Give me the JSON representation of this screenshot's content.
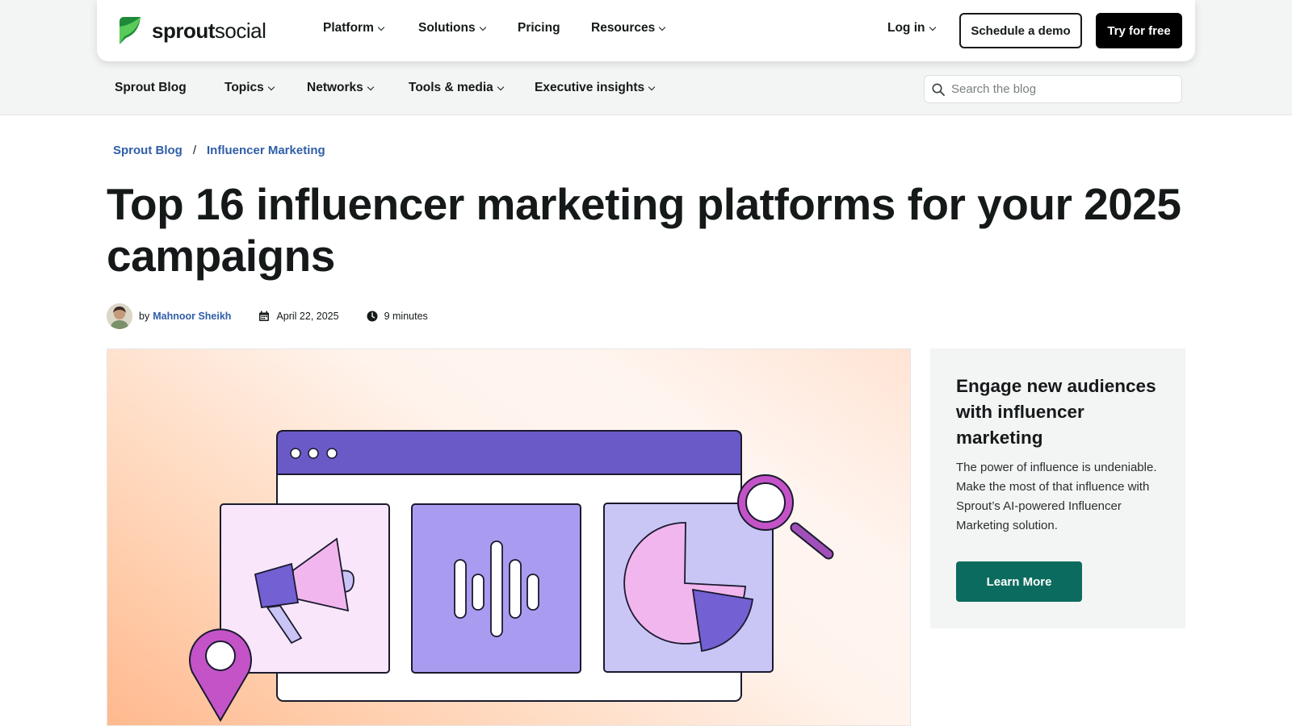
{
  "brand": {
    "logo_bold": "sprout",
    "logo_light": "social",
    "logo_icon": "sprout-leaf-icon",
    "accent_color": "#59cb59"
  },
  "main_nav": {
    "items": [
      {
        "label": "Platform",
        "has_dropdown": true
      },
      {
        "label": "Solutions",
        "has_dropdown": true
      },
      {
        "label": "Pricing",
        "has_dropdown": false
      },
      {
        "label": "Resources",
        "has_dropdown": true
      }
    ],
    "login_label": "Log in",
    "demo_label": "Schedule a demo",
    "try_label": "Try for free"
  },
  "sub_nav": {
    "items": [
      {
        "label": "Sprout Blog",
        "has_dropdown": false
      },
      {
        "label": "Topics",
        "has_dropdown": true
      },
      {
        "label": "Networks",
        "has_dropdown": true
      },
      {
        "label": "Tools & media",
        "has_dropdown": true
      },
      {
        "label": "Executive insights",
        "has_dropdown": true
      }
    ],
    "search_placeholder": "Search the blog"
  },
  "breadcrumb": {
    "items": [
      "Sprout Blog",
      "Influencer Marketing"
    ],
    "separator": "/"
  },
  "article": {
    "title": "Top 16 influencer marketing platforms for your 2025 campaigns",
    "by_label": "by",
    "author": "Mahnoor Sheikh",
    "date": "April 22, 2025",
    "read_time": "9 minutes",
    "link_color": "#2f5ea8"
  },
  "aside": {
    "title": "Engage new audiences with influencer marketing",
    "body": "The power of influence is undeniable. Make the most of that influence with Sprout’s AI-powered Influencer Marketing solution.",
    "button_label": "Learn More",
    "button_color": "#0b6b5e"
  }
}
